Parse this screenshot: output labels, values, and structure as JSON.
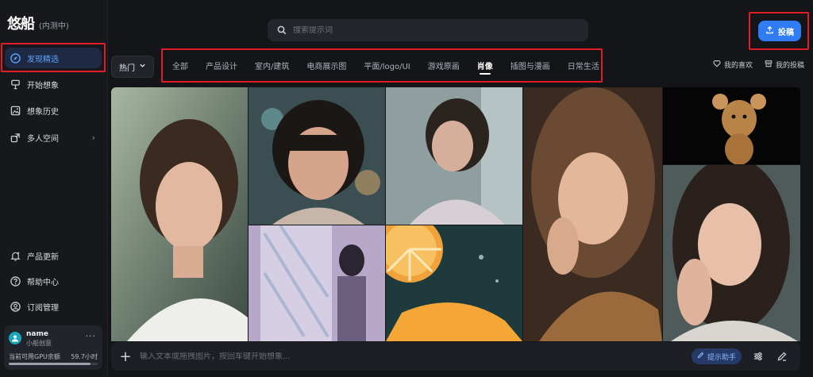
{
  "brand": {
    "logo": "悠船",
    "badge": "(内测中)"
  },
  "sidebar": {
    "top_items": [
      {
        "label": "发现精选",
        "icon": "compass-icon",
        "active": true
      },
      {
        "label": "开始想象",
        "icon": "brush-icon"
      },
      {
        "label": "想象历史",
        "icon": "image-icon"
      },
      {
        "label": "多人空间",
        "icon": "share-space-icon"
      }
    ],
    "bottom_items": [
      {
        "label": "产品更新",
        "icon": "bell-icon"
      },
      {
        "label": "帮助中心",
        "icon": "help-icon"
      },
      {
        "label": "订阅管理",
        "icon": "user-icon"
      }
    ],
    "user": {
      "name": "name",
      "tier": "小船创意",
      "gpu_label": "当前可用GPU余额",
      "gpu_value": "59.7小时",
      "gpu_fraction": 0.92
    }
  },
  "header": {
    "search_placeholder": "搜索提示词",
    "submit_label": "投稿"
  },
  "filters": {
    "sort_label": "热门",
    "tabs": [
      "全部",
      "产品设计",
      "室内/建筑",
      "电商展示图",
      "平面/logo/UI",
      "游戏原画",
      "肖像",
      "插图与漫画",
      "日常生活"
    ],
    "active_tab": "肖像",
    "favorites_label": "我的喜欢",
    "submissions_label": "我的投稿"
  },
  "prompt_bar": {
    "placeholder": "输入文本或拖拽图片，按回车键开始想象...",
    "assist_label": "提示助手"
  },
  "colors": {
    "accent": "#2f7cf6",
    "highlight_box": "#e11d2a",
    "active_nav_bg": "#1e2a44"
  }
}
